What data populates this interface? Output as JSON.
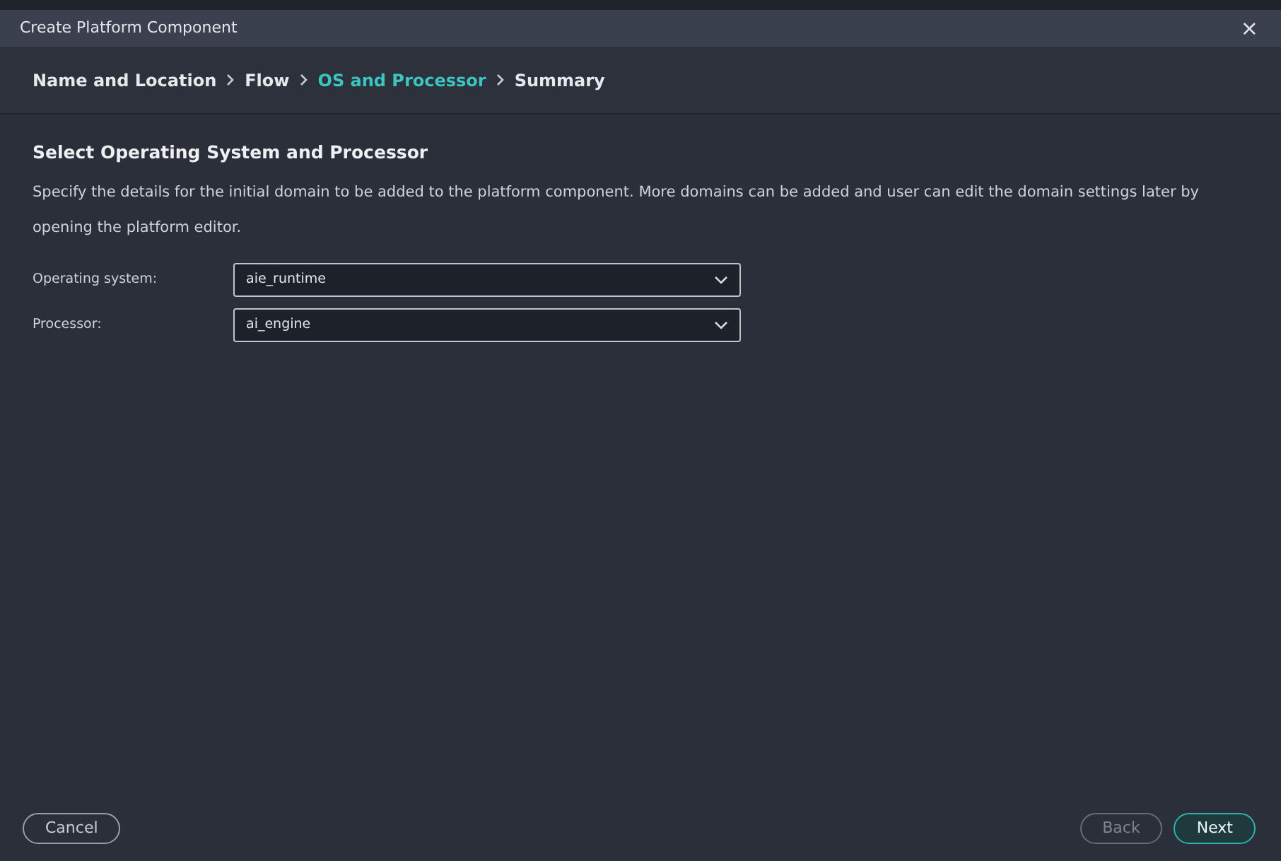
{
  "window": {
    "title": "Create Platform Component",
    "close": "×"
  },
  "steps": [
    {
      "label": "Name and Location",
      "selected": false
    },
    {
      "label": "Flow",
      "selected": false
    },
    {
      "label": "OS and Processor",
      "selected": true
    },
    {
      "label": "Summary",
      "selected": false
    }
  ],
  "heading": "Select Operating System and Processor",
  "description": "Specify the details for the initial domain to be added to the platform component. More domains can be added and user can edit the domain settings later by opening the platform editor.",
  "fields": [
    {
      "label": "Operating system:",
      "value": "aie_runtime"
    },
    {
      "label": "Processor:",
      "value": "ai_engine"
    }
  ],
  "buttons": [
    {
      "label": "Cancel",
      "kind": "cancel",
      "disabled": false
    },
    {
      "label": "Back",
      "kind": "back",
      "disabled": true
    },
    {
      "label": "Next",
      "kind": "next",
      "disabled": false
    }
  ]
}
